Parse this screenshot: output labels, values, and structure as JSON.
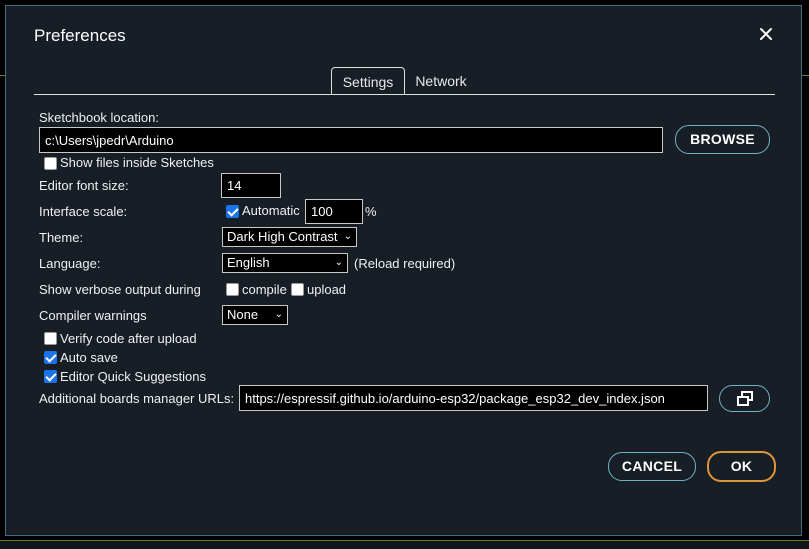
{
  "dialog": {
    "title": "Preferences",
    "tabs": [
      {
        "label": "Settings"
      },
      {
        "label": "Network"
      }
    ]
  },
  "settings": {
    "sketchbook_label": "Sketchbook location:",
    "sketchbook_value": "c:\\Users\\jpedr\\Arduino",
    "browse_label": "BROWSE",
    "show_files_label": "Show files inside Sketches",
    "show_files_checked": false,
    "font_size_label": "Editor font size:",
    "font_size_value": "14",
    "interface_scale_label": "Interface scale:",
    "automatic_label": "Automatic",
    "automatic_checked": true,
    "scale_value": "100",
    "scale_unit": "%",
    "theme_label": "Theme:",
    "theme_value": "Dark High Contrast",
    "language_label": "Language:",
    "language_value": "English",
    "reload_note": "(Reload required)",
    "verbose_label": "Show verbose output during",
    "compile_label": "compile",
    "compile_checked": false,
    "upload_label": "upload",
    "upload_checked": false,
    "warnings_label": "Compiler warnings",
    "warnings_value": "None",
    "verify_label": "Verify code after upload",
    "verify_checked": false,
    "autosave_label": "Auto save",
    "autosave_checked": true,
    "quick_suggest_label": "Editor Quick Suggestions",
    "quick_suggest_checked": true,
    "boards_urls_label": "Additional boards manager URLs:",
    "boards_urls_value": "https://espressif.github.io/arduino-esp32/package_esp32_dev_index.json"
  },
  "footer": {
    "cancel_label": "CANCEL",
    "ok_label": "OK"
  },
  "colors": {
    "dialog_bg": "#171e26",
    "accent_border": "#6fb2c4",
    "primary_border": "#e0943a",
    "checkbox_checked": "#1a73e8"
  }
}
